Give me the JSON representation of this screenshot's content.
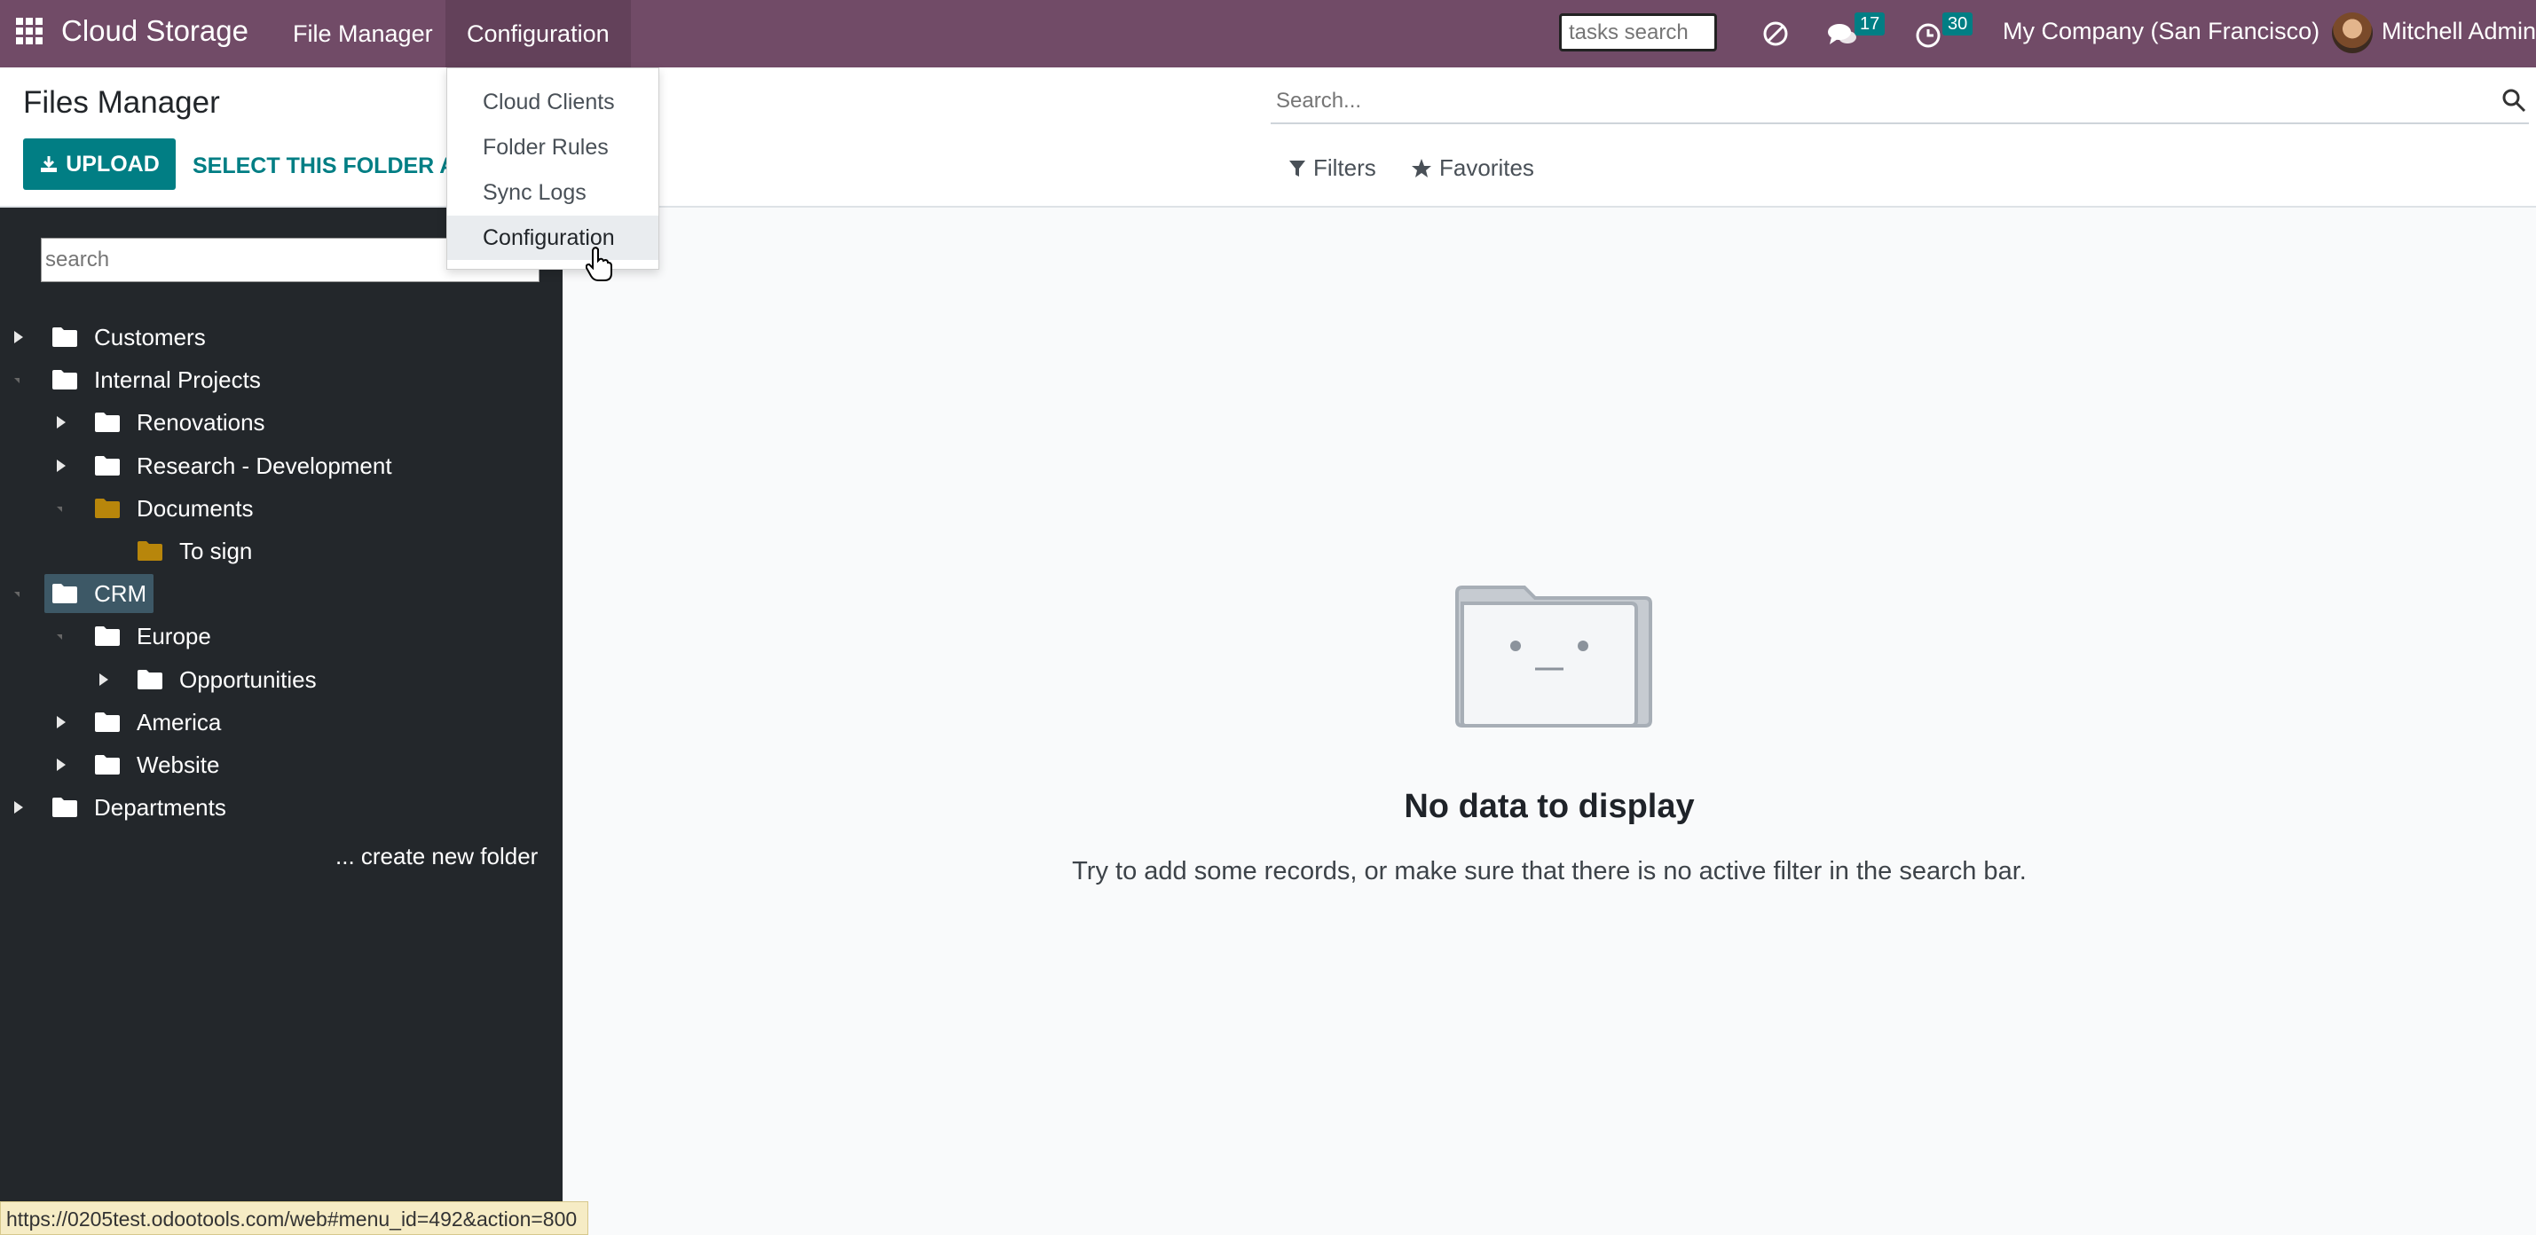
{
  "navbar": {
    "brand": "Cloud Storage",
    "menus": [
      "File Manager",
      "Configuration"
    ],
    "tasks_search_placeholder": "tasks search",
    "messages_count": "17",
    "activities_count": "30",
    "company": "My Company (San Francisco)",
    "user_name": "Mitchell Admin"
  },
  "control_panel": {
    "title": "Files Manager",
    "upload_label": "UPLOAD",
    "select_folder_label": "SELECT THIS FOLDER AT",
    "search_placeholder": "Search...",
    "filters_label": "Filters",
    "favorites_label": "Favorites"
  },
  "dropdown": {
    "items": [
      "Cloud Clients",
      "Folder Rules",
      "Sync Logs",
      "Configuration"
    ]
  },
  "sidebar": {
    "search_placeholder": "search",
    "tree": [
      {
        "label": "Customers",
        "caret": "right",
        "color": "white"
      },
      {
        "label": "Internal Projects",
        "caret": "down",
        "color": "white"
      },
      {
        "label": "Renovations",
        "caret": "right",
        "color": "white"
      },
      {
        "label": "Research - Development",
        "caret": "right",
        "color": "white"
      },
      {
        "label": "Documents",
        "caret": "down",
        "color": "gold"
      },
      {
        "label": "To sign",
        "caret": "none",
        "color": "gold"
      },
      {
        "label": "CRM",
        "caret": "down",
        "color": "white",
        "selected": true
      },
      {
        "label": "Europe",
        "caret": "down",
        "color": "white"
      },
      {
        "label": "Opportunities",
        "caret": "right",
        "color": "white"
      },
      {
        "label": "America",
        "caret": "right",
        "color": "white"
      },
      {
        "label": "Website",
        "caret": "right",
        "color": "white"
      },
      {
        "label": "Departments",
        "caret": "right",
        "color": "white"
      }
    ],
    "create_folder_label": "... create new folder"
  },
  "main": {
    "empty_title": "No data to display",
    "empty_hint": "Try to add some records, or make sure that there is no active filter in the search bar."
  },
  "status_bar": {
    "url": "https://0205test.odootools.com/web#menu_id=492&action=800"
  },
  "colors": {
    "navbar": "#714B67",
    "accent": "#017e84",
    "sidebar": "#23272b",
    "folder_gold": "#b8860b",
    "selected": "#3d5866"
  }
}
